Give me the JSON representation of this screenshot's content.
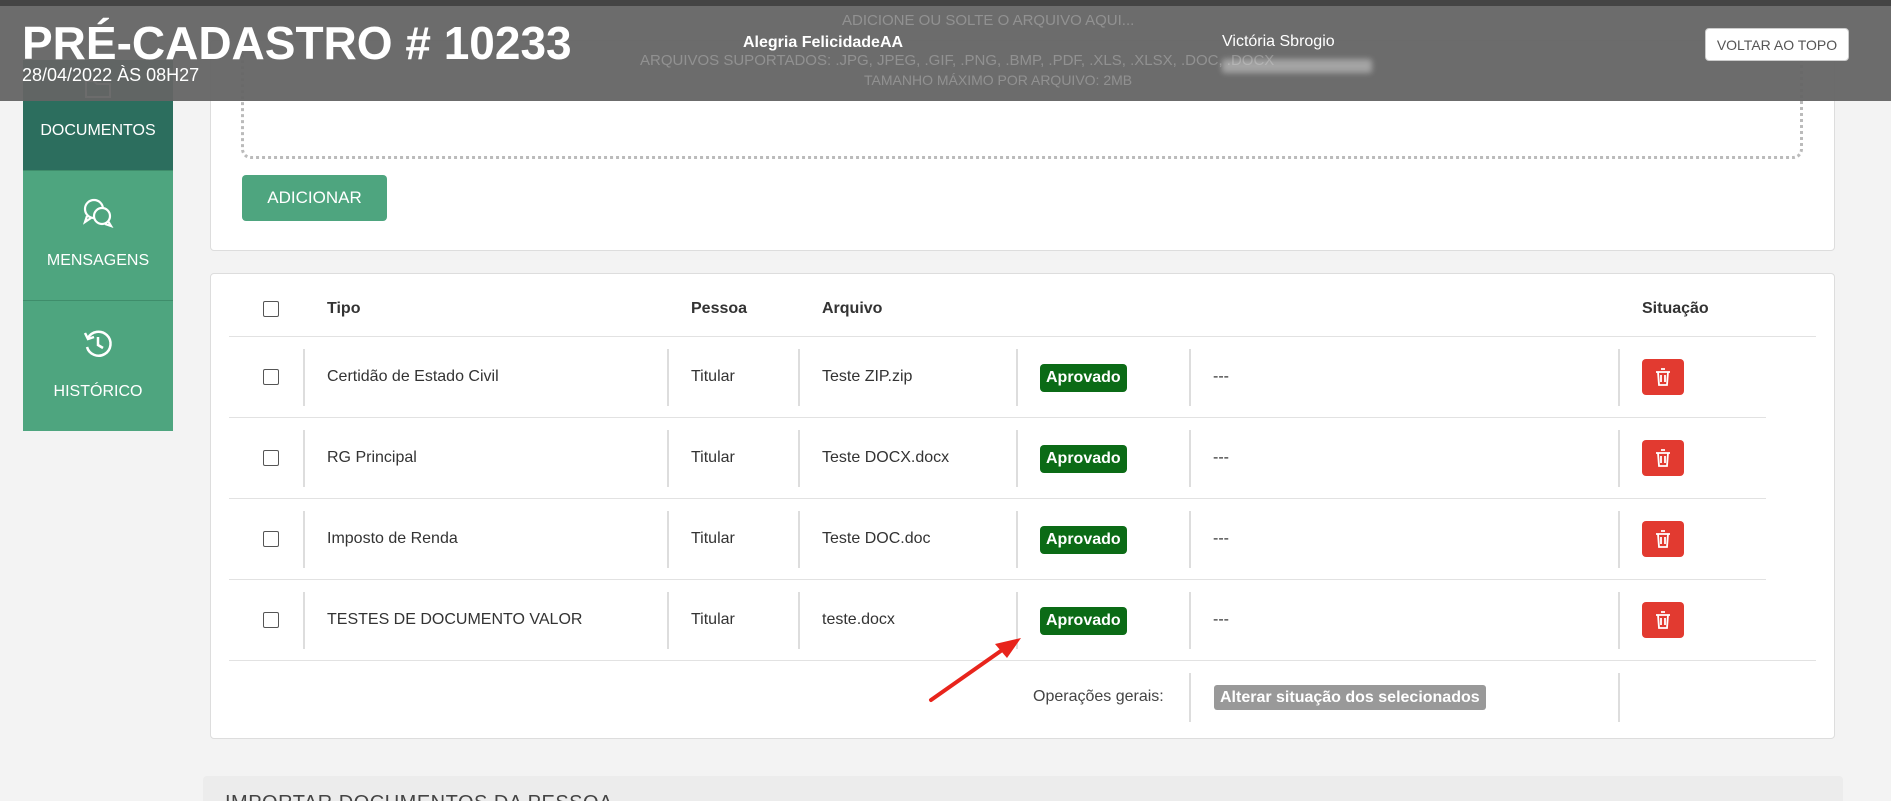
{
  "header": {
    "title": "PRÉ-CADASTRO # 10233",
    "date": "28/04/2022 ÀS 08H27",
    "client": "Alegria FelicidadeAA",
    "user": "Victória Sbrogio",
    "back_to_top": "VOLTAR AO TOPO",
    "ghost_top": "ADICIONE OU SOLTE O ARQUIVO AQUI...",
    "ghost_formats": "ARQUIVOS SUPORTADOS: .JPG, JPEG, .GIF, .PNG, .BMP, .PDF, .XLS, .XLSX, .DOC, .DOCX",
    "ghost_size": "TAMANHO MÁXIMO POR ARQUIVO: 2MB"
  },
  "sidebar": {
    "items": [
      {
        "label": "DOCUMENTOS",
        "icon": "folder-icon"
      },
      {
        "label": "MENSAGENS",
        "icon": "chat-bubbles-icon"
      },
      {
        "label": "HISTÓRICO",
        "icon": "history-icon"
      }
    ]
  },
  "upload": {
    "add_label": "ADICIONAR"
  },
  "table": {
    "headers": {
      "tipo": "Tipo",
      "pessoa": "Pessoa",
      "arquivo": "Arquivo",
      "situacao": "Situação"
    },
    "rows": [
      {
        "tipo": "Certidão de Estado Civil",
        "pessoa": "Titular",
        "arquivo": "Teste ZIP.zip",
        "status": "Aprovado",
        "obs": "---"
      },
      {
        "tipo": "RG Principal",
        "pessoa": "Titular",
        "arquivo": "Teste DOCX.docx",
        "status": "Aprovado",
        "obs": "---"
      },
      {
        "tipo": "Imposto de Renda",
        "pessoa": "Titular",
        "arquivo": "Teste DOC.doc",
        "status": "Aprovado",
        "obs": "---"
      },
      {
        "tipo": "TESTES DE DOCUMENTO VALOR",
        "pessoa": "Titular",
        "arquivo": "teste.docx",
        "status": "Aprovado",
        "obs": "---"
      }
    ],
    "ops_label": "Operações gerais:",
    "ops_button": "Alterar situação dos selecionados"
  },
  "import": {
    "title": "IMPORTAR DOCUMENTOS DA PESSOA"
  },
  "colors": {
    "sidebar_dark": "#2c6e5e",
    "sidebar_green": "#4ea57f",
    "approved": "#0b6b16",
    "delete": "#e23a30",
    "arrow": "#e8241c"
  }
}
